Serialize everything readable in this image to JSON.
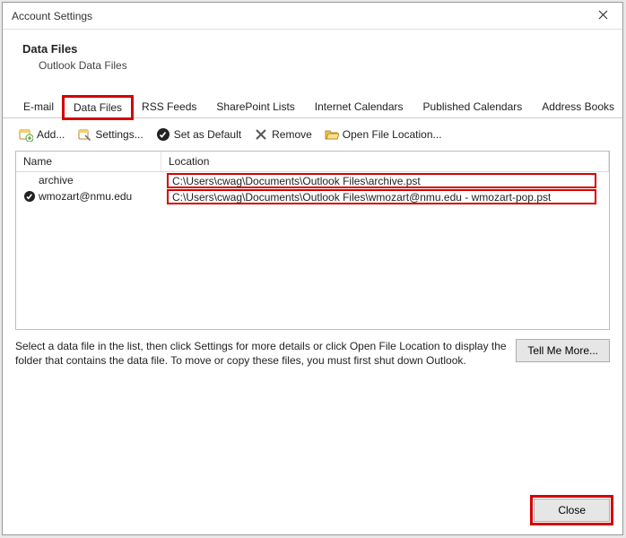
{
  "window": {
    "title": "Account Settings"
  },
  "header": {
    "title": "Data Files",
    "subtitle": "Outlook Data Files"
  },
  "tabs": {
    "items": [
      {
        "label": "E-mail"
      },
      {
        "label": "Data Files"
      },
      {
        "label": "RSS Feeds"
      },
      {
        "label": "SharePoint Lists"
      },
      {
        "label": "Internet Calendars"
      },
      {
        "label": "Published Calendars"
      },
      {
        "label": "Address Books"
      }
    ],
    "active_index": 1
  },
  "toolbar": {
    "add": "Add...",
    "settings": "Settings...",
    "set_default": "Set as Default",
    "remove": "Remove",
    "open_location": "Open File Location..."
  },
  "list": {
    "columns": {
      "name": "Name",
      "location": "Location"
    },
    "rows": [
      {
        "name": "archive",
        "location": "C:\\Users\\cwag\\Documents\\Outlook Files\\archive.pst",
        "default": false
      },
      {
        "name": "wmozart@nmu.edu",
        "location": "C:\\Users\\cwag\\Documents\\Outlook Files\\wmozart@nmu.edu - wmozart-pop.pst",
        "default": true
      }
    ]
  },
  "help": {
    "text": "Select a data file in the list, then click Settings for more details or click Open File Location to display the folder that contains the data file. To move or copy these files, you must first shut down Outlook.",
    "tell_me_more": "Tell Me More..."
  },
  "footer": {
    "close": "Close"
  }
}
